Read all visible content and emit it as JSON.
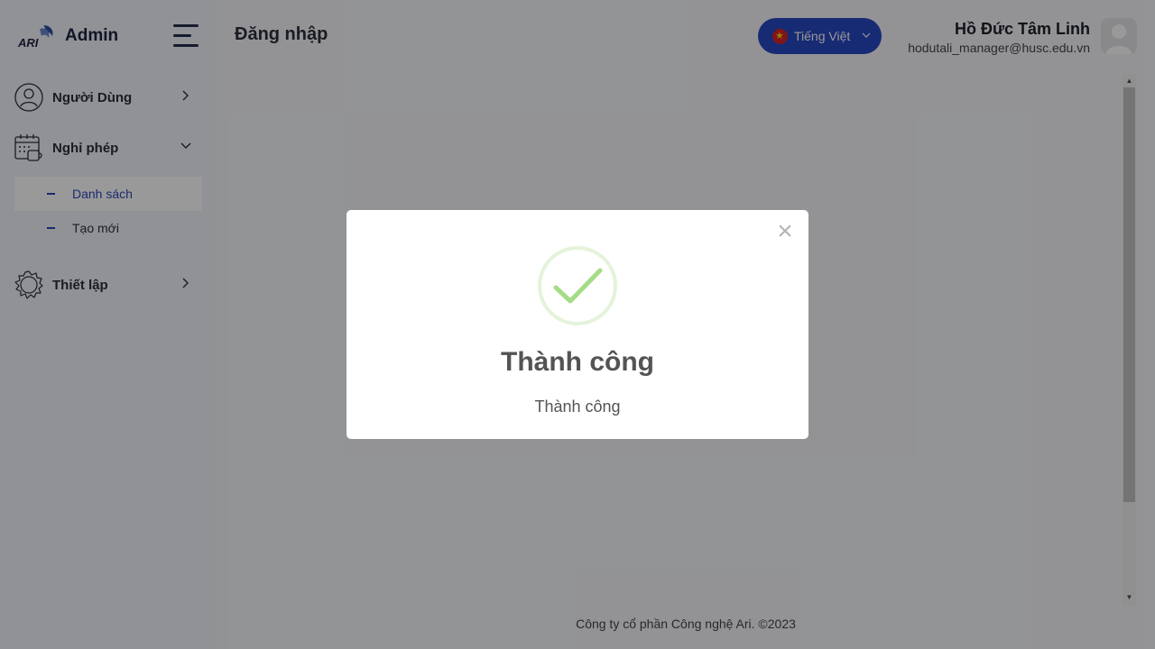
{
  "sidebar": {
    "brand": {
      "logo_text": "ARI",
      "name": "Admin"
    },
    "items": [
      {
        "label": "Người Dùng",
        "icon": "user-circle-icon",
        "chevron": "chevron-right-icon"
      },
      {
        "label": "Nghỉ phép",
        "icon": "calendar-coffee-icon",
        "chevron": "chevron-down-icon",
        "children": [
          {
            "label": "Danh sách",
            "active": true
          },
          {
            "label": "Tạo mới",
            "active": false
          }
        ]
      },
      {
        "label": "Thiết lập",
        "icon": "gear-icon",
        "chevron": "chevron-right-icon"
      }
    ]
  },
  "header": {
    "page_title": "Đăng nhập",
    "language": {
      "label": "Tiếng Việt",
      "flag": "vietnam-flag-icon"
    },
    "user": {
      "name": "Hồ Đức Tâm Linh",
      "email": "hodutali_manager@husc.edu.vn"
    }
  },
  "footer": {
    "text": "Công ty cổ phần Công nghệ Ari. ©2023"
  },
  "modal": {
    "icon": "success-check-icon",
    "title": "Thành công",
    "message": "Thành công",
    "close": "×"
  },
  "colors": {
    "accent": "#2746c2",
    "success": "#a5dc86",
    "sidebar_bg": "#f1f3fb",
    "overlay": "rgba(0,0,0,0.4)"
  }
}
